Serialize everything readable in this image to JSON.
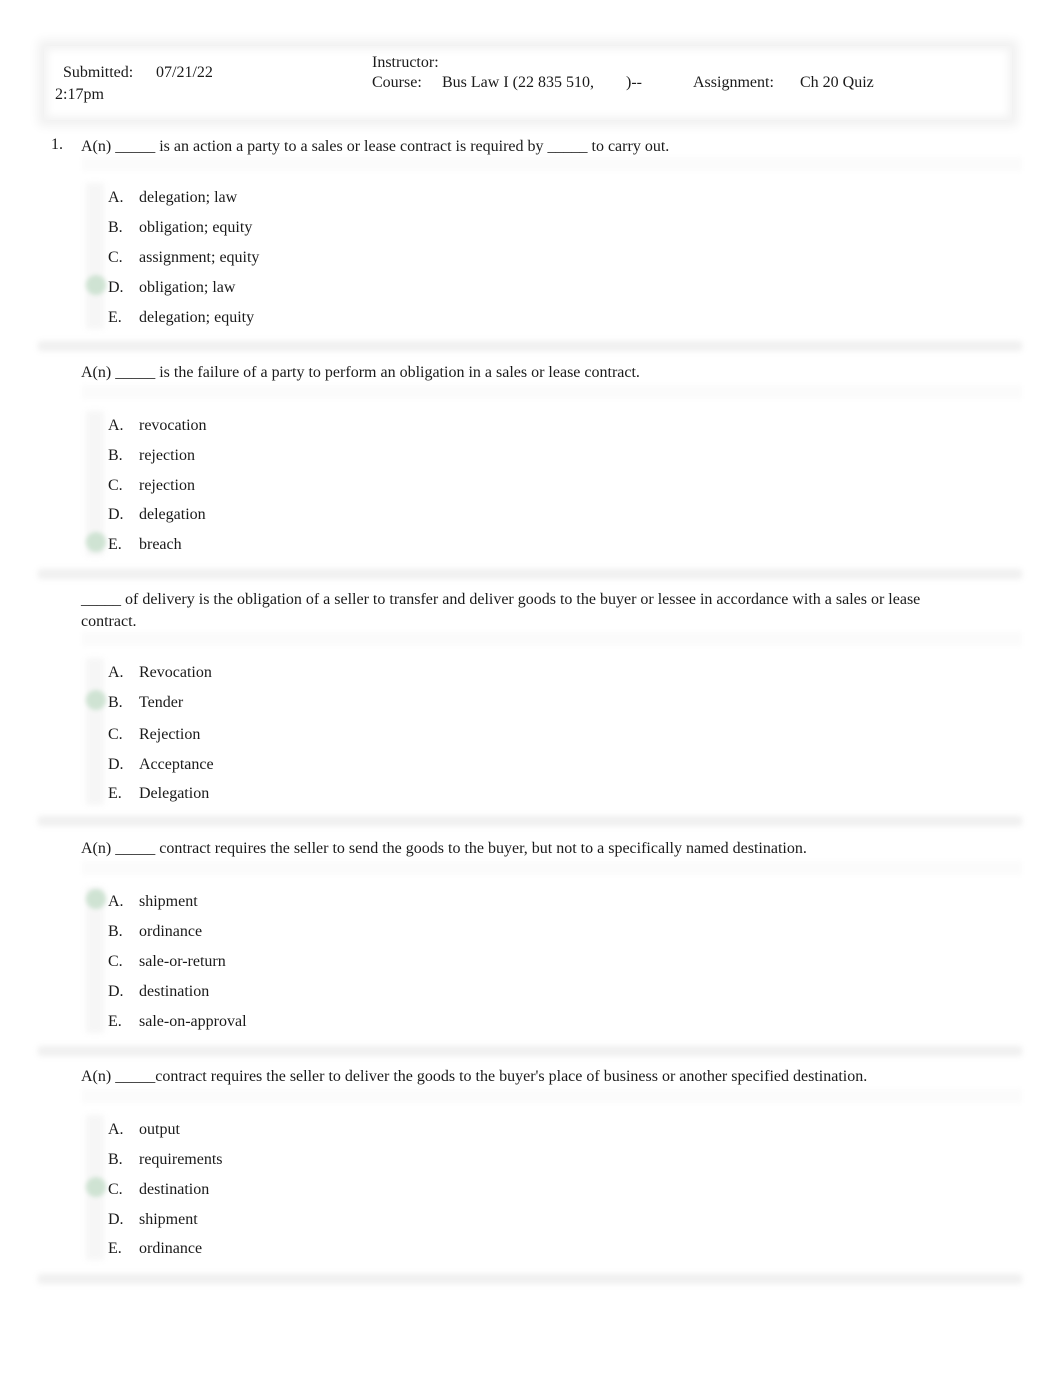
{
  "header": {
    "submitted_label": "Submitted:",
    "submitted_date": "07/21/22",
    "submitted_time": "2:17pm",
    "instructor_label": "Instructor:",
    "instructor_value": "",
    "course_label": "Course:",
    "course_value": "Bus Law I (22 835 510,",
    "course_suffix": ")--",
    "assignment_label": "Assignment:",
    "assignment_value": "Ch 20 Quiz"
  },
  "accent_colors": {
    "correct_marker": "#cfe3d3"
  },
  "questions": [
    {
      "number": "1.",
      "text": "A(n) _____ is an action a party to a sales or lease contract is required by _____ to carry out.",
      "options": [
        {
          "letter": "A.",
          "text": "delegation; law",
          "correct": false
        },
        {
          "letter": "B.",
          "text": "obligation; equity",
          "correct": false
        },
        {
          "letter": "C.",
          "text": "assignment; equity",
          "correct": false
        },
        {
          "letter": "D.",
          "text": "obligation; law",
          "correct": true
        },
        {
          "letter": "E.",
          "text": "delegation; equity",
          "correct": false
        }
      ]
    },
    {
      "number": "",
      "text": "A(n) _____ is the failure of a party to perform an obligation in a sales or lease contract.",
      "options": [
        {
          "letter": "A.",
          "text": "revocation",
          "correct": false
        },
        {
          "letter": "B.",
          "text": "rejection",
          "correct": false
        },
        {
          "letter": "C.",
          "text": "rejection",
          "correct": false
        },
        {
          "letter": "D.",
          "text": "delegation",
          "correct": false
        },
        {
          "letter": "E.",
          "text": "breach",
          "correct": true
        }
      ]
    },
    {
      "number": "",
      "text": "_____ of delivery is the obligation of a seller to transfer and deliver goods to the buyer or lessee in accordance with a sales or lease contract.",
      "options": [
        {
          "letter": "A.",
          "text": "Revocation",
          "correct": false
        },
        {
          "letter": "B.",
          "text": "Tender",
          "correct": true
        },
        {
          "letter": "C.",
          "text": "Rejection",
          "correct": false
        },
        {
          "letter": "D.",
          "text": "Acceptance",
          "correct": false
        },
        {
          "letter": "E.",
          "text": "Delegation",
          "correct": false
        }
      ]
    },
    {
      "number": "",
      "text": "A(n) _____ contract requires the seller to send the goods to the buyer, but not to a specifically named destination.",
      "options": [
        {
          "letter": "A.",
          "text": "shipment",
          "correct": true
        },
        {
          "letter": "B.",
          "text": "ordinance",
          "correct": false
        },
        {
          "letter": "C.",
          "text": "sale-or-return",
          "correct": false
        },
        {
          "letter": "D.",
          "text": "destination",
          "correct": false
        },
        {
          "letter": "E.",
          "text": "sale-on-approval",
          "correct": false
        }
      ]
    },
    {
      "number": "",
      "text": "A(n) _____contract requires the seller to deliver the goods to the buyer's place of business or another specified destination.",
      "options": [
        {
          "letter": "A.",
          "text": "output",
          "correct": false
        },
        {
          "letter": "B.",
          "text": "requirements",
          "correct": false
        },
        {
          "letter": "C.",
          "text": "destination",
          "correct": true
        },
        {
          "letter": "D.",
          "text": "shipment",
          "correct": false
        },
        {
          "letter": "E.",
          "text": "ordinance",
          "correct": false
        }
      ]
    }
  ]
}
